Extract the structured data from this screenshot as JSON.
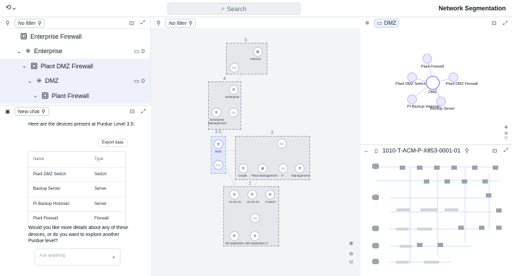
{
  "header": {
    "search_placeholder": "Search",
    "title": "Network Segmentation"
  },
  "tree_panel": {
    "filter": "No filter",
    "items": [
      {
        "label": "Enterprise Firewall",
        "count": ""
      },
      {
        "label": "Enterprise",
        "count": "0"
      },
      {
        "label": "Plant DMZ Firewall",
        "count": ""
      },
      {
        "label": "DMZ",
        "count": "0"
      },
      {
        "label": "Plant Firewall",
        "count": ""
      }
    ]
  },
  "chat": {
    "tab_label": "New chat",
    "intro": "Here are the devices present at Purdue Level 3.5:",
    "export_label": "Export data",
    "table": {
      "headers": [
        "Name",
        "Type"
      ],
      "rows": [
        [
          "Plant DMZ Switch",
          "Switch"
        ],
        [
          "Backup Server",
          "Server"
        ],
        [
          "PI Backup Historian",
          "Server"
        ],
        [
          "Plant Firewall",
          "Firewall"
        ]
      ]
    },
    "followup": [
      "Would you like more details about any of these",
      "devices, or do you want to explore another",
      "Purdue level?"
    ],
    "input_placeholder": "Ask anything"
  },
  "graph": {
    "filter": "No filter",
    "levels": [
      "5",
      "4",
      "3.5",
      "3",
      "2"
    ],
    "node_labels": {
      "internet": "Internet",
      "enterprise": "Enterprise",
      "ent_mgmt": [
        "Enterprise",
        "Management"
      ],
      "dmz": "DMZ",
      "grade": "Grade",
      "plant_mgmt": "Plant Management",
      "it": "IT",
      "management": "Management",
      "vlan11": "VLAN 11",
      "vlan23": "VLAN 23",
      "control": "Control",
      "oil1": "Oil separation 1",
      "oil2": "Oil separation 2"
    }
  },
  "dmz_panel": {
    "tab_label": "DMZ",
    "nodes": [
      "Plant Firewall",
      "Plant DMZ Switch",
      "Plant DMZ Firewall",
      "DMZ",
      "PI Backup Historian",
      "Backup Server"
    ]
  },
  "doc_panel": {
    "tab_label": "1010-T-ACM-P-X853-0001-01"
  },
  "colors": {
    "accent": "#6366f1",
    "selected_bg": "#eef0fb",
    "graph_bg": "#f3f4f6"
  }
}
